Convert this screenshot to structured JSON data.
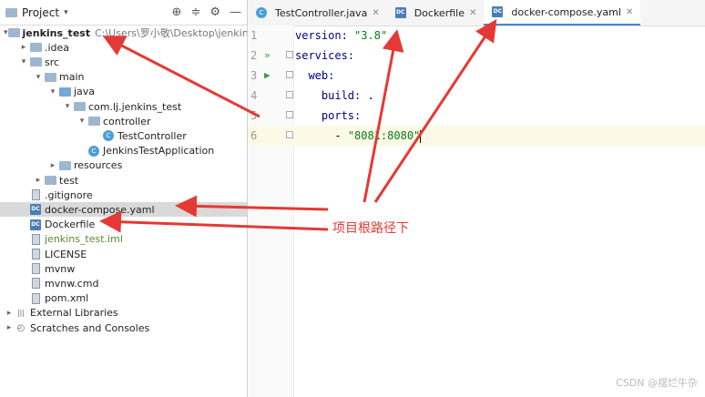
{
  "left_panel": {
    "title": "Project",
    "toolbar_icons": [
      "target-icon",
      "collapse-icon",
      "gear-icon",
      "minimize-icon"
    ]
  },
  "tree": [
    {
      "label": "jenkins_test",
      "extra": "C:\\Users\\罗小敬\\Desktop\\jenkins_test",
      "indent": 0,
      "arrow": "▾",
      "icon": "folder",
      "bold": true
    },
    {
      "label": ".idea",
      "indent": 1,
      "arrow": "▸",
      "icon": "folder"
    },
    {
      "label": "src",
      "indent": 1,
      "arrow": "▾",
      "icon": "folder"
    },
    {
      "label": "main",
      "indent": 2,
      "arrow": "▾",
      "icon": "folder"
    },
    {
      "label": "java",
      "indent": 3,
      "arrow": "▾",
      "icon": "folder-blue"
    },
    {
      "label": "com.lj.jenkins_test",
      "indent": 4,
      "arrow": "▾",
      "icon": "folder"
    },
    {
      "label": "controller",
      "indent": 5,
      "arrow": "▾",
      "icon": "folder"
    },
    {
      "label": "TestController",
      "indent": 6,
      "arrow": "",
      "icon": "class"
    },
    {
      "label": "JenkinsTestApplication",
      "indent": 5,
      "arrow": "",
      "icon": "class"
    },
    {
      "label": "resources",
      "indent": 3,
      "arrow": "▸",
      "icon": "folder"
    },
    {
      "label": "test",
      "indent": 2,
      "arrow": "▸",
      "icon": "folder"
    },
    {
      "label": ".gitignore",
      "indent": 1,
      "arrow": "",
      "icon": "file"
    },
    {
      "label": "docker-compose.yaml",
      "indent": 1,
      "arrow": "",
      "icon": "dc",
      "selected": true
    },
    {
      "label": "Dockerfile",
      "indent": 1,
      "arrow": "",
      "icon": "dc"
    },
    {
      "label": "jenkins_test.iml",
      "indent": 1,
      "arrow": "",
      "icon": "file",
      "green": true
    },
    {
      "label": "LICENSE",
      "indent": 1,
      "arrow": "",
      "icon": "file"
    },
    {
      "label": "mvnw",
      "indent": 1,
      "arrow": "",
      "icon": "file"
    },
    {
      "label": "mvnw.cmd",
      "indent": 1,
      "arrow": "",
      "icon": "file"
    },
    {
      "label": "pom.xml",
      "indent": 1,
      "arrow": "",
      "icon": "file"
    },
    {
      "label": "External Libraries",
      "indent": 0,
      "arrow": "▸",
      "icon": "library"
    },
    {
      "label": "Scratches and Consoles",
      "indent": 0,
      "arrow": "▸",
      "icon": "scratch"
    }
  ],
  "tabs": [
    {
      "label": "TestController.java",
      "icon": "class",
      "active": false
    },
    {
      "label": "Dockerfile",
      "icon": "dc",
      "active": false
    },
    {
      "label": "docker-compose.yaml",
      "icon": "dc",
      "active": true
    }
  ],
  "editor": {
    "lines": [
      {
        "num": "1",
        "key": "version:",
        "val": " \"3.8\"",
        "indent": ""
      },
      {
        "num": "2",
        "key": "services:",
        "val": "",
        "indent": "",
        "gutter": "run-all-icon"
      },
      {
        "num": "3",
        "key": "web:",
        "val": "",
        "indent": "  ",
        "gutter": "run-icon"
      },
      {
        "num": "4",
        "key": "build:",
        "val": " .",
        "indent": "    "
      },
      {
        "num": "5",
        "key": "ports:",
        "val": "",
        "indent": "    "
      },
      {
        "num": "6",
        "key": "- ",
        "val": "\"8081:8080\"",
        "indent": "      ",
        "current": true
      }
    ]
  },
  "annotation": "项目根路径下",
  "watermark": "CSDN @摆烂牛杂"
}
